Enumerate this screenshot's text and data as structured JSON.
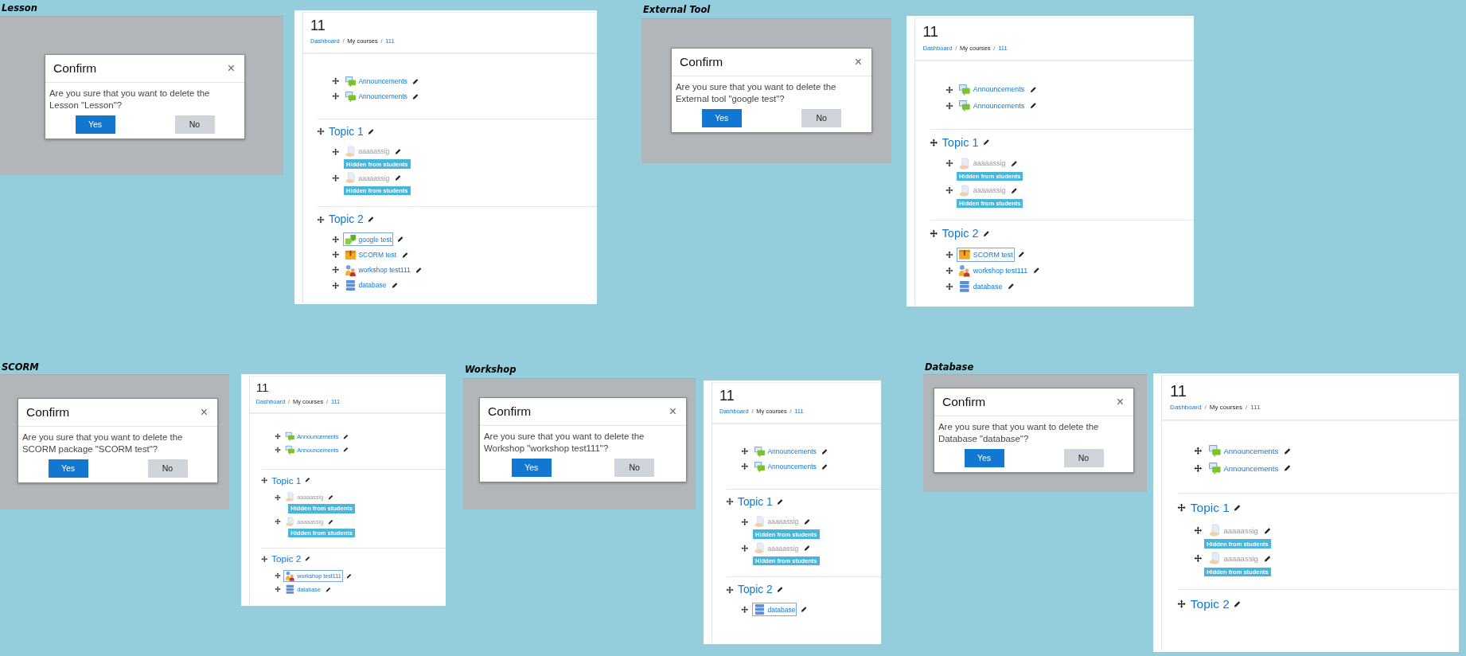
{
  "panels": [
    {
      "caption": "Lesson",
      "dialog": {
        "title": "Confirm",
        "close": "×",
        "message": "Are you sure that you want to delete the Lesson \"Lesson\"?",
        "buttons": [
          {
            "label": "Yes",
            "kind": "primary"
          },
          {
            "label": "No",
            "kind": "secondary"
          }
        ]
      },
      "course": {
        "title": "11",
        "breadcrumb": [
          {
            "label": "Dashboard",
            "kind": "link"
          },
          {
            "label": "/",
            "kind": "separator"
          },
          {
            "label": "My courses",
            "kind": "text"
          },
          {
            "label": "/",
            "kind": "separator"
          },
          {
            "label": "111",
            "kind": "link"
          }
        ],
        "sections": [
          {
            "activities": [
              {
                "kind": "forum",
                "name": "Announcements",
                "hidden": false,
                "focused": false
              },
              {
                "kind": "forum",
                "name": "Announcements",
                "hidden": false,
                "focused": false
              }
            ]
          },
          {
            "title": "Topic 1",
            "activities": [
              {
                "kind": "assign",
                "name": "aaaaassig",
                "hidden": true,
                "focused": false,
                "badge": "Hidden from students"
              },
              {
                "kind": "assign",
                "name": "aaaaassig",
                "hidden": true,
                "focused": false,
                "badge": "Hidden from students"
              }
            ]
          },
          {
            "title": "Topic 2",
            "activities": [
              {
                "kind": "lti",
                "name": "google test",
                "hidden": false,
                "focused": true
              },
              {
                "kind": "scorm",
                "name": "SCORM test",
                "hidden": false,
                "focused": false
              },
              {
                "kind": "workshop",
                "name": "workshop test111",
                "hidden": false,
                "focused": false
              },
              {
                "kind": "data",
                "name": "database",
                "hidden": false,
                "focused": false
              }
            ]
          }
        ]
      }
    },
    {
      "caption": "External Tool",
      "dialog": {
        "title": "Confirm",
        "close": "×",
        "message": "Are you sure that you want to delete the External tool \"google test\"?",
        "buttons": [
          {
            "label": "Yes",
            "kind": "primary"
          },
          {
            "label": "No",
            "kind": "secondary"
          }
        ]
      },
      "course": {
        "title": "11",
        "breadcrumb": [
          {
            "label": "Dashboard",
            "kind": "link"
          },
          {
            "label": "/",
            "kind": "separator"
          },
          {
            "label": "My courses",
            "kind": "text"
          },
          {
            "label": "/",
            "kind": "separator"
          },
          {
            "label": "111",
            "kind": "link"
          }
        ],
        "sections": [
          {
            "activities": [
              {
                "kind": "forum",
                "name": "Announcements",
                "hidden": false,
                "focused": false
              },
              {
                "kind": "forum",
                "name": "Announcements",
                "hidden": false,
                "focused": false
              }
            ]
          },
          {
            "title": "Topic 1",
            "activities": [
              {
                "kind": "assign",
                "name": "aaaaassig",
                "hidden": true,
                "focused": false,
                "badge": "Hidden from students"
              },
              {
                "kind": "assign",
                "name": "aaaaassig",
                "hidden": true,
                "focused": false,
                "badge": "Hidden from students"
              }
            ]
          },
          {
            "title": "Topic 2",
            "activities": [
              {
                "kind": "scorm",
                "name": "SCORM test",
                "hidden": false,
                "focused": true
              },
              {
                "kind": "workshop",
                "name": "workshop test111",
                "hidden": false,
                "focused": false
              },
              {
                "kind": "data",
                "name": "database",
                "hidden": false,
                "focused": false
              }
            ]
          }
        ]
      }
    },
    {
      "caption": "SCORM",
      "dialog": {
        "title": "Confirm",
        "close": "×",
        "message": "Are you sure that you want to delete the SCORM package \"SCORM test\"?",
        "buttons": [
          {
            "label": "Yes",
            "kind": "primary"
          },
          {
            "label": "No",
            "kind": "secondary"
          }
        ]
      },
      "course": {
        "title": "11",
        "breadcrumb": [
          {
            "label": "Dashboard",
            "kind": "link"
          },
          {
            "label": "/",
            "kind": "separator"
          },
          {
            "label": "My courses",
            "kind": "text"
          },
          {
            "label": "/",
            "kind": "separator"
          },
          {
            "label": "111",
            "kind": "link"
          }
        ],
        "sections": [
          {
            "activities": [
              {
                "kind": "forum",
                "name": "Announcements",
                "hidden": false,
                "focused": false
              },
              {
                "kind": "forum",
                "name": "Announcements",
                "hidden": false,
                "focused": false
              }
            ]
          },
          {
            "title": "Topic 1",
            "activities": [
              {
                "kind": "assign",
                "name": "aaaaassig",
                "hidden": true,
                "focused": false,
                "badge": "Hidden from students"
              },
              {
                "kind": "assign",
                "name": "aaaaassig",
                "hidden": true,
                "focused": false,
                "badge": "Hidden from students"
              }
            ]
          },
          {
            "title": "Topic 2",
            "activities": [
              {
                "kind": "workshop",
                "name": "workshop test111",
                "hidden": false,
                "focused": true
              },
              {
                "kind": "data",
                "name": "database",
                "hidden": false,
                "focused": false
              }
            ]
          }
        ]
      }
    },
    {
      "caption": "Workshop",
      "dialog": {
        "title": "Confirm",
        "close": "×",
        "message": "Are you sure that you want to delete the Workshop \"workshop test111\"?",
        "buttons": [
          {
            "label": "Yes",
            "kind": "primary"
          },
          {
            "label": "No",
            "kind": "secondary"
          }
        ]
      },
      "course": {
        "title": "11",
        "breadcrumb": [
          {
            "label": "Dashboard",
            "kind": "link"
          },
          {
            "label": "/",
            "kind": "separator"
          },
          {
            "label": "My courses",
            "kind": "text"
          },
          {
            "label": "/",
            "kind": "separator"
          },
          {
            "label": "111",
            "kind": "link"
          }
        ],
        "sections": [
          {
            "activities": [
              {
                "kind": "forum",
                "name": "Announcements",
                "hidden": false,
                "focused": false
              },
              {
                "kind": "forum",
                "name": "Announcements",
                "hidden": false,
                "focused": false
              }
            ]
          },
          {
            "title": "Topic 1",
            "activities": [
              {
                "kind": "assign",
                "name": "aaaaassig",
                "hidden": true,
                "focused": false,
                "badge": "Hidden from students"
              },
              {
                "kind": "assign",
                "name": "aaaaassig",
                "hidden": true,
                "focused": false,
                "badge": "Hidden from students"
              }
            ]
          },
          {
            "title": "Topic 2",
            "activities": [
              {
                "kind": "data",
                "name": "database",
                "hidden": false,
                "focused": true
              }
            ]
          }
        ]
      }
    },
    {
      "caption": "Database",
      "dialog": {
        "title": "Confirm",
        "close": "×",
        "message": "Are you sure that you want to delete the Database \"database\"?",
        "buttons": [
          {
            "label": "Yes",
            "kind": "primary"
          },
          {
            "label": "No",
            "kind": "secondary"
          }
        ]
      },
      "course": {
        "title": "11",
        "breadcrumb": [
          {
            "label": "Dashboard",
            "kind": "link"
          },
          {
            "label": "/",
            "kind": "separator"
          },
          {
            "label": "My courses",
            "kind": "text"
          },
          {
            "label": "/",
            "kind": "separator"
          },
          {
            "label": "111",
            "kind": "link"
          }
        ],
        "sections": [
          {
            "activities": [
              {
                "kind": "forum",
                "name": "Announcements",
                "hidden": false,
                "focused": false
              },
              {
                "kind": "forum",
                "name": "Announcements",
                "hidden": false,
                "focused": false
              }
            ]
          },
          {
            "title": "Topic 1",
            "activities": [
              {
                "kind": "assign",
                "name": "aaaaassig",
                "hidden": true,
                "focused": false,
                "badge": "Hidden from students"
              },
              {
                "kind": "assign",
                "name": "aaaaassig",
                "hidden": true,
                "focused": false,
                "badge": "Hidden from students"
              }
            ]
          },
          {
            "title": "Topic 2"
          }
        ]
      }
    }
  ]
}
